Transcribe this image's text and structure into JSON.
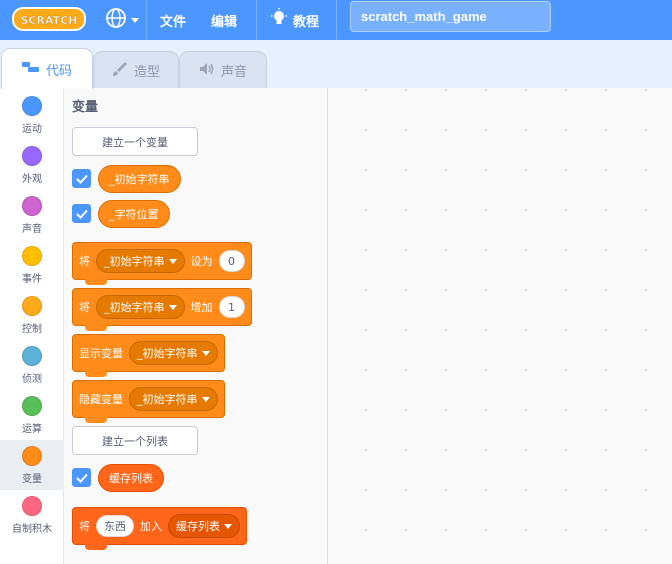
{
  "menubar": {
    "logo_text": "SCRATCH",
    "file_label": "文件",
    "edit_label": "编辑",
    "tutorials_label": "教程",
    "project_title": "scratch_math_game",
    "brand_color": "#4c97ff"
  },
  "tabs": [
    {
      "label": "代码",
      "icon": "code-icon",
      "active": true
    },
    {
      "label": "造型",
      "icon": "brush-icon",
      "active": false
    },
    {
      "label": "声音",
      "icon": "speaker-icon",
      "active": false
    }
  ],
  "categories": [
    {
      "label": "运动",
      "color": "#4c97ff"
    },
    {
      "label": "外观",
      "color": "#9966ff"
    },
    {
      "label": "声音",
      "color": "#cf63cf"
    },
    {
      "label": "事件",
      "color": "#ffbf00"
    },
    {
      "label": "控制",
      "color": "#ffab19"
    },
    {
      "label": "侦测",
      "color": "#5cb1d6"
    },
    {
      "label": "运算",
      "color": "#59c059"
    },
    {
      "label": "变量",
      "color": "#ff8c1a",
      "selected": true
    },
    {
      "label": "自制积木",
      "color": "#ff6680"
    }
  ],
  "flyout": {
    "section_title": "变量",
    "make_variable_label": "建立一个变量",
    "variables": [
      "_初始字符串",
      "_字符位置"
    ],
    "set_block": {
      "prefix": "将",
      "variable": "_初始字符串",
      "verb": "设为",
      "value": "0"
    },
    "change_block": {
      "prefix": "将",
      "variable": "_初始字符串",
      "verb": "增加",
      "value": "1"
    },
    "show_block": {
      "prefix": "显示变量",
      "variable": "_初始字符串"
    },
    "hide_block": {
      "prefix": "隐藏变量",
      "variable": "_初始字符串"
    },
    "make_list_label": "建立一个列表",
    "lists": [
      "缓存列表"
    ],
    "add_to_list_block": {
      "prefix": "将",
      "value": "东西",
      "verb": "加入",
      "list": "缓存列表"
    }
  }
}
